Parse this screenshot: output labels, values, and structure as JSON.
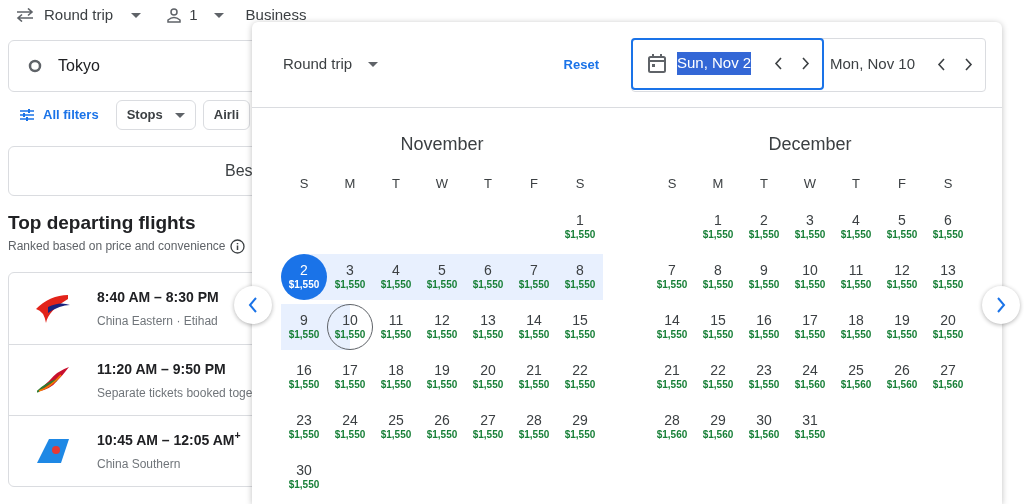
{
  "top_bar": {
    "trip_type": "Round trip",
    "passengers": "1",
    "cabin": "Business"
  },
  "search": {
    "origin": "Tokyo"
  },
  "filters": {
    "all_filters": "All filters",
    "chips": [
      {
        "label": "Stops",
        "caret": true
      },
      {
        "label": "Airli",
        "caret": false
      }
    ]
  },
  "sort_card": {
    "label": "Bes"
  },
  "section": {
    "title": "Top departing flights",
    "subtitle": "Ranked based on price and convenience"
  },
  "flights": [
    {
      "kind": "swoosh",
      "times": "8:40 AM – 8:30 PM",
      "details": "China Eastern · Etihad"
    },
    {
      "kind": "feather",
      "times": "11:20 AM – 9:50 PM",
      "details": "Separate tickets booked toge"
    },
    {
      "kind": "tail",
      "times": "10:45 AM – 12:05 AM$^{+}$",
      "details": "China Southern"
    }
  ],
  "date_picker": {
    "trip_type": "Round trip",
    "reset": "Reset",
    "departure": {
      "value": "Sun, Nov 2",
      "focused": true
    },
    "return": {
      "value": "Mon, Nov 10",
      "focused": false
    },
    "months": [
      {
        "name": "November",
        "weekdays": [
          "S",
          "M",
          "T",
          "W",
          "T",
          "F",
          "S"
        ],
        "weeks": [
          {
            "align_right": true,
            "days": [
              {
                "day": "1",
                "price": "$1,550",
                "departure": false,
                "return": false,
                "in_range": false
              }
            ]
          },
          {
            "days": [
              {
                "day": "2",
                "price": "$1,550",
                "departure": true,
                "return": false,
                "in_range": true
              },
              {
                "day": "3",
                "price": "$1,550",
                "departure": false,
                "return": false,
                "in_range": true
              },
              {
                "day": "4",
                "price": "$1,550",
                "departure": false,
                "return": false,
                "in_range": true
              },
              {
                "day": "5",
                "price": "$1,550",
                "departure": false,
                "return": false,
                "in_range": true
              },
              {
                "day": "6",
                "price": "$1,550",
                "departure": false,
                "return": false,
                "in_range": true
              },
              {
                "day": "7",
                "price": "$1,550",
                "departure": false,
                "return": false,
                "in_range": true
              },
              {
                "day": "8",
                "price": "$1,550",
                "departure": false,
                "return": false,
                "in_range": true
              }
            ]
          },
          {
            "days": [
              {
                "day": "9",
                "price": "$1,550",
                "departure": false,
                "return": false,
                "in_range": true
              },
              {
                "day": "10",
                "price": "$1,550",
                "departure": false,
                "return": true,
                "in_range": true
              },
              {
                "day": "11",
                "price": "$1,550",
                "departure": false,
                "return": false,
                "in_range": false
              },
              {
                "day": "12",
                "price": "$1,550",
                "departure": false,
                "return": false,
                "in_range": false
              },
              {
                "day": "13",
                "price": "$1,550",
                "departure": false,
                "return": false,
                "in_range": false
              },
              {
                "day": "14",
                "price": "$1,550",
                "departure": false,
                "return": false,
                "in_range": false
              },
              {
                "day": "15",
                "price": "$1,550",
                "departure": false,
                "return": false,
                "in_range": false
              }
            ]
          },
          {
            "days": [
              {
                "day": "16",
                "price": "$1,550",
                "departure": false,
                "return": false,
                "in_range": false
              },
              {
                "day": "17",
                "price": "$1,550",
                "departure": false,
                "return": false,
                "in_range": false
              },
              {
                "day": "18",
                "price": "$1,550",
                "departure": false,
                "return": false,
                "in_range": false
              },
              {
                "day": "19",
                "price": "$1,550",
                "departure": false,
                "return": false,
                "in_range": false
              },
              {
                "day": "20",
                "price": "$1,550",
                "departure": false,
                "return": false,
                "in_range": false
              },
              {
                "day": "21",
                "price": "$1,550",
                "departure": false,
                "return": false,
                "in_range": false
              },
              {
                "day": "22",
                "price": "$1,550",
                "departure": false,
                "return": false,
                "in_range": false
              }
            ]
          },
          {
            "days": [
              {
                "day": "23",
                "price": "$1,550",
                "departure": false,
                "return": false,
                "in_range": false
              },
              {
                "day": "24",
                "price": "$1,550",
                "departure": false,
                "return": false,
                "in_range": false
              },
              {
                "day": "25",
                "price": "$1,550",
                "departure": false,
                "return": false,
                "in_range": false
              },
              {
                "day": "26",
                "price": "$1,550",
                "departure": false,
                "return": false,
                "in_range": false
              },
              {
                "day": "27",
                "price": "$1,550",
                "departure": false,
                "return": false,
                "in_range": false
              },
              {
                "day": "28",
                "price": "$1,550",
                "departure": false,
                "return": false,
                "in_range": false
              },
              {
                "day": "29",
                "price": "$1,550",
                "departure": false,
                "return": false,
                "in_range": false
              }
            ]
          },
          {
            "align_right": false,
            "days": [
              {
                "day": "30",
                "price": "$1,550",
                "departure": false,
                "return": false,
                "in_range": false
              }
            ]
          }
        ]
      },
      {
        "name": "December",
        "weekdays": [
          "S",
          "M",
          "T",
          "W",
          "T",
          "F",
          "S"
        ],
        "weeks": [
          {
            "align_right": true,
            "days": [
              {
                "day": "1",
                "price": "$1,550",
                "departure": false,
                "return": false,
                "in_range": false
              },
              {
                "day": "2",
                "price": "$1,550",
                "departure": false,
                "return": false,
                "in_range": false
              },
              {
                "day": "3",
                "price": "$1,550",
                "departure": false,
                "return": false,
                "in_range": false
              },
              {
                "day": "4",
                "price": "$1,550",
                "departure": false,
                "return": false,
                "in_range": false
              },
              {
                "day": "5",
                "price": "$1,550",
                "departure": false,
                "return": false,
                "in_range": false
              },
              {
                "day": "6",
                "price": "$1,550",
                "departure": false,
                "return": false,
                "in_range": false
              }
            ]
          },
          {
            "days": [
              {
                "day": "7",
                "price": "$1,550",
                "departure": false,
                "return": false,
                "in_range": false
              },
              {
                "day": "8",
                "price": "$1,550",
                "departure": false,
                "return": false,
                "in_range": false
              },
              {
                "day": "9",
                "price": "$1,550",
                "departure": false,
                "return": false,
                "in_range": false
              },
              {
                "day": "10",
                "price": "$1,550",
                "departure": false,
                "return": false,
                "in_range": false
              },
              {
                "day": "11",
                "price": "$1,550",
                "departure": false,
                "return": false,
                "in_range": false
              },
              {
                "day": "12",
                "price": "$1,550",
                "departure": false,
                "return": false,
                "in_range": false
              },
              {
                "day": "13",
                "price": "$1,550",
                "departure": false,
                "return": false,
                "in_range": false
              }
            ]
          },
          {
            "days": [
              {
                "day": "14",
                "price": "$1,550",
                "departure": false,
                "return": false,
                "in_range": false
              },
              {
                "day": "15",
                "price": "$1,550",
                "departure": false,
                "return": false,
                "in_range": false
              },
              {
                "day": "16",
                "price": "$1,550",
                "departure": false,
                "return": false,
                "in_range": false
              },
              {
                "day": "17",
                "price": "$1,550",
                "departure": false,
                "return": false,
                "in_range": false
              },
              {
                "day": "18",
                "price": "$1,550",
                "departure": false,
                "return": false,
                "in_range": false
              },
              {
                "day": "19",
                "price": "$1,550",
                "departure": false,
                "return": false,
                "in_range": false
              },
              {
                "day": "20",
                "price": "$1,550",
                "departure": false,
                "return": false,
                "in_range": false
              }
            ]
          },
          {
            "days": [
              {
                "day": "21",
                "price": "$1,550",
                "departure": false,
                "return": false,
                "in_range": false
              },
              {
                "day": "22",
                "price": "$1,550",
                "departure": false,
                "return": false,
                "in_range": false
              },
              {
                "day": "23",
                "price": "$1,550",
                "departure": false,
                "return": false,
                "in_range": false
              },
              {
                "day": "24",
                "price": "$1,560",
                "departure": false,
                "return": false,
                "in_range": false
              },
              {
                "day": "25",
                "price": "$1,560",
                "departure": false,
                "return": false,
                "in_range": false
              },
              {
                "day": "26",
                "price": "$1,560",
                "departure": false,
                "return": false,
                "in_range": false
              },
              {
                "day": "27",
                "price": "$1,560",
                "departure": false,
                "return": false,
                "in_range": false
              }
            ]
          },
          {
            "align_right": false,
            "days": [
              {
                "day": "28",
                "price": "$1,560",
                "departure": false,
                "return": false,
                "in_range": false
              },
              {
                "day": "29",
                "price": "$1,560",
                "departure": false,
                "return": false,
                "in_range": false
              },
              {
                "day": "30",
                "price": "$1,560",
                "departure": false,
                "return": false,
                "in_range": false
              },
              {
                "day": "31",
                "price": "$1,550",
                "departure": false,
                "return": false,
                "in_range": false
              }
            ]
          }
        ]
      }
    ]
  }
}
